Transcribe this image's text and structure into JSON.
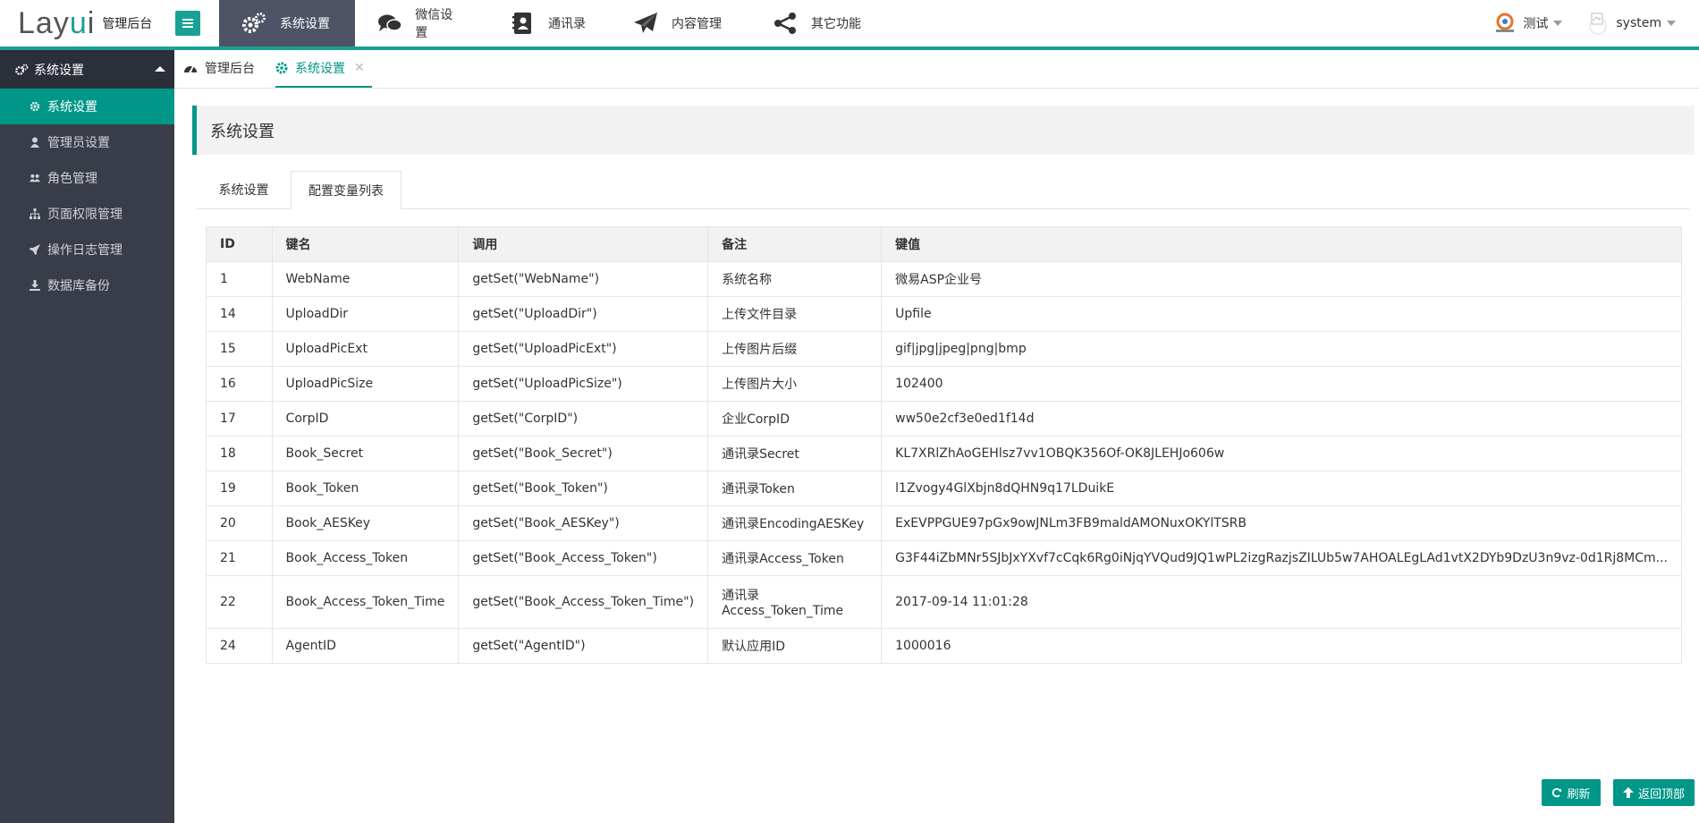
{
  "header": {
    "logo_text_a": "Lay",
    "logo_text_i": "u",
    "logo_text_b": "i",
    "logo_subtitle": "管理后台",
    "nav": [
      {
        "label": "系统设置",
        "icon": "gears-icon",
        "active": true
      },
      {
        "label": "微信设置",
        "icon": "chat-bubbles-icon",
        "active": false
      },
      {
        "label": "通讯录",
        "icon": "address-book-icon",
        "active": false
      },
      {
        "label": "内容管理",
        "icon": "paper-plane-icon",
        "active": false
      },
      {
        "label": "其它功能",
        "icon": "share-icon",
        "active": false
      }
    ],
    "right": {
      "site_label": "测试",
      "user_label": "system"
    }
  },
  "sidebar": {
    "section_title": "系统设置",
    "items": [
      {
        "label": "系统设置",
        "icon": "gear-icon",
        "active": true
      },
      {
        "label": "管理员设置",
        "icon": "user-icon",
        "active": false
      },
      {
        "label": "角色管理",
        "icon": "users-icon",
        "active": false
      },
      {
        "label": "页面权限管理",
        "icon": "sitemap-icon",
        "active": false
      },
      {
        "label": "操作日志管理",
        "icon": "rocket-icon",
        "active": false
      },
      {
        "label": "数据库备份",
        "icon": "download-icon",
        "active": false
      }
    ]
  },
  "tabs": [
    {
      "label": "管理后台",
      "icon": "dashboard-icon",
      "active": false
    },
    {
      "label": "系统设置",
      "icon": "gear-icon",
      "active": true
    }
  ],
  "page": {
    "title": "系统设置",
    "subtabs": [
      {
        "label": "系统设置",
        "active": false
      },
      {
        "label": "配置变量列表",
        "active": true
      }
    ]
  },
  "table": {
    "columns": [
      "ID",
      "键名",
      "调用",
      "备注",
      "键值"
    ],
    "rows": [
      [
        "1",
        "WebName",
        "getSet(\"WebName\")",
        "系统名称",
        "微易ASP企业号"
      ],
      [
        "14",
        "UploadDir",
        "getSet(\"UploadDir\")",
        "上传文件目录",
        "Upfile"
      ],
      [
        "15",
        "UploadPicExt",
        "getSet(\"UploadPicExt\")",
        "上传图片后缀",
        "gif|jpg|jpeg|png|bmp"
      ],
      [
        "16",
        "UploadPicSize",
        "getSet(\"UploadPicSize\")",
        "上传图片大小",
        "102400"
      ],
      [
        "17",
        "CorpID",
        "getSet(\"CorpID\")",
        "企业CorpID",
        "ww50e2cf3e0ed1f14d"
      ],
      [
        "18",
        "Book_Secret",
        "getSet(\"Book_Secret\")",
        "通讯录Secret",
        "KL7XRlZhAoGEHlsz7vv1OBQK356Of-OK8JLEHJo606w"
      ],
      [
        "19",
        "Book_Token",
        "getSet(\"Book_Token\")",
        "通讯录Token",
        "l1Zvogy4GlXbjn8dQHN9q17LDuikE"
      ],
      [
        "20",
        "Book_AESKey",
        "getSet(\"Book_AESKey\")",
        "通讯录EncodingAESKey",
        "ExEVPPGUE97pGx9owJNLm3FB9maldAMONuxOKYlTSRB"
      ],
      [
        "21",
        "Book_Access_Token",
        "getSet(\"Book_Access_Token\")",
        "通讯录Access_Token",
        "G3F44iZbMNr5SJbJxYXvf7cCqk6Rg0iNjqYVQud9JQ1wPL2izgRazjsZILUb5w7AHOALEgLAd1vtX2DYb9DzU3n9vz-0d1Rj8MCm..."
      ],
      [
        "22",
        "Book_Access_Token_Time",
        "getSet(\"Book_Access_Token_Time\")",
        "通讯录\nAccess_Token_Time",
        "2017-09-14 11:01:28"
      ],
      [
        "24",
        "AgentID",
        "getSet(\"AgentID\")",
        "默认应用ID",
        "1000016"
      ]
    ]
  },
  "buttons": {
    "refresh": "刷新",
    "back_to_top": "返回顶部"
  },
  "colors": {
    "accent": "#009688",
    "header_accent": "#1aa094",
    "sidebar_bg": "#393d49",
    "sidebar_head_bg": "#2b2f3a",
    "nav_active_bg": "#4e5465"
  }
}
